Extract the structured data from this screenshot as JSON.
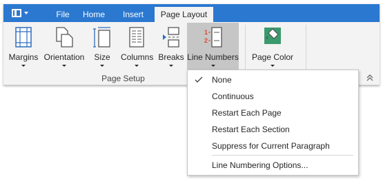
{
  "tabs": [
    {
      "label": "File"
    },
    {
      "label": "Home"
    },
    {
      "label": "Insert"
    },
    {
      "label": "Page Layout"
    }
  ],
  "page_setup": {
    "group_label": "Page Setup",
    "buttons": [
      {
        "label": "Margins",
        "icon": "margins-icon"
      },
      {
        "label": "Orientation",
        "icon": "orientation-icon"
      },
      {
        "label": "Size",
        "icon": "size-icon"
      },
      {
        "label": "Columns",
        "icon": "columns-icon"
      },
      {
        "label": "Breaks",
        "icon": "breaks-icon"
      },
      {
        "label": "Line Numbers",
        "icon": "line-numbers-icon",
        "pressed": true
      }
    ]
  },
  "background_group": {
    "buttons": [
      {
        "label": "Page Color",
        "icon": "page-color-icon"
      }
    ]
  },
  "line_numbers_menu": {
    "items": [
      {
        "label": "None",
        "checked": true
      },
      {
        "label": "Continuous"
      },
      {
        "label": "Restart Each Page"
      },
      {
        "label": "Restart Each Section"
      },
      {
        "label": "Suppress for Current Paragraph"
      },
      {
        "label": "Line Numbering Options..."
      }
    ]
  },
  "colors": {
    "title_bar": "#2b78d0",
    "ribbon_bg": "#f3f3f3",
    "pressed_bg": "#c6c6c6",
    "icon_blue": "#2e6dbd",
    "icon_red": "#d9462e",
    "page_color_teal": "#3a9a6e"
  }
}
